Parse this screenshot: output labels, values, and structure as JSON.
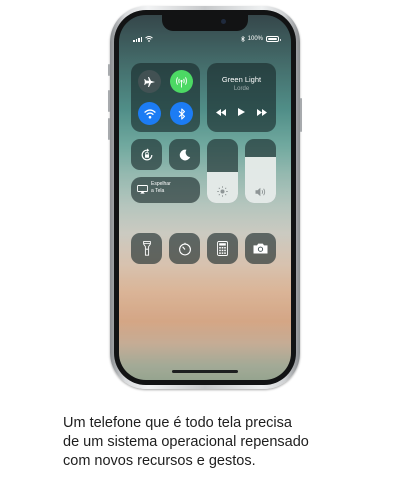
{
  "status_bar": {
    "battery_text": "100%"
  },
  "connectivity": {
    "airplane_icon": "airplane-icon",
    "cellular_icon": "cellular-data-icon",
    "wifi_icon": "wifi-icon",
    "bluetooth_icon": "bluetooth-icon",
    "active_colors": {
      "cellular": "#4cd964",
      "wifi": "#1c7cf4",
      "bluetooth": "#1c7cf4"
    }
  },
  "music": {
    "title": "Green Light",
    "artist": "Lorde"
  },
  "screen_mirroring": {
    "label_line1": "Espelhar",
    "label_line2": "a Tela"
  },
  "sliders": {
    "brightness_level": 0.48,
    "volume_level": 0.72
  },
  "shortcuts": [
    "flashlight-icon",
    "timer-icon",
    "calculator-icon",
    "camera-icon"
  ],
  "caption": {
    "line1": "Um telefone que é todo tela precisa",
    "line2": "de um sistema operacional repensado",
    "line3": "com novos recursos e gestos."
  }
}
